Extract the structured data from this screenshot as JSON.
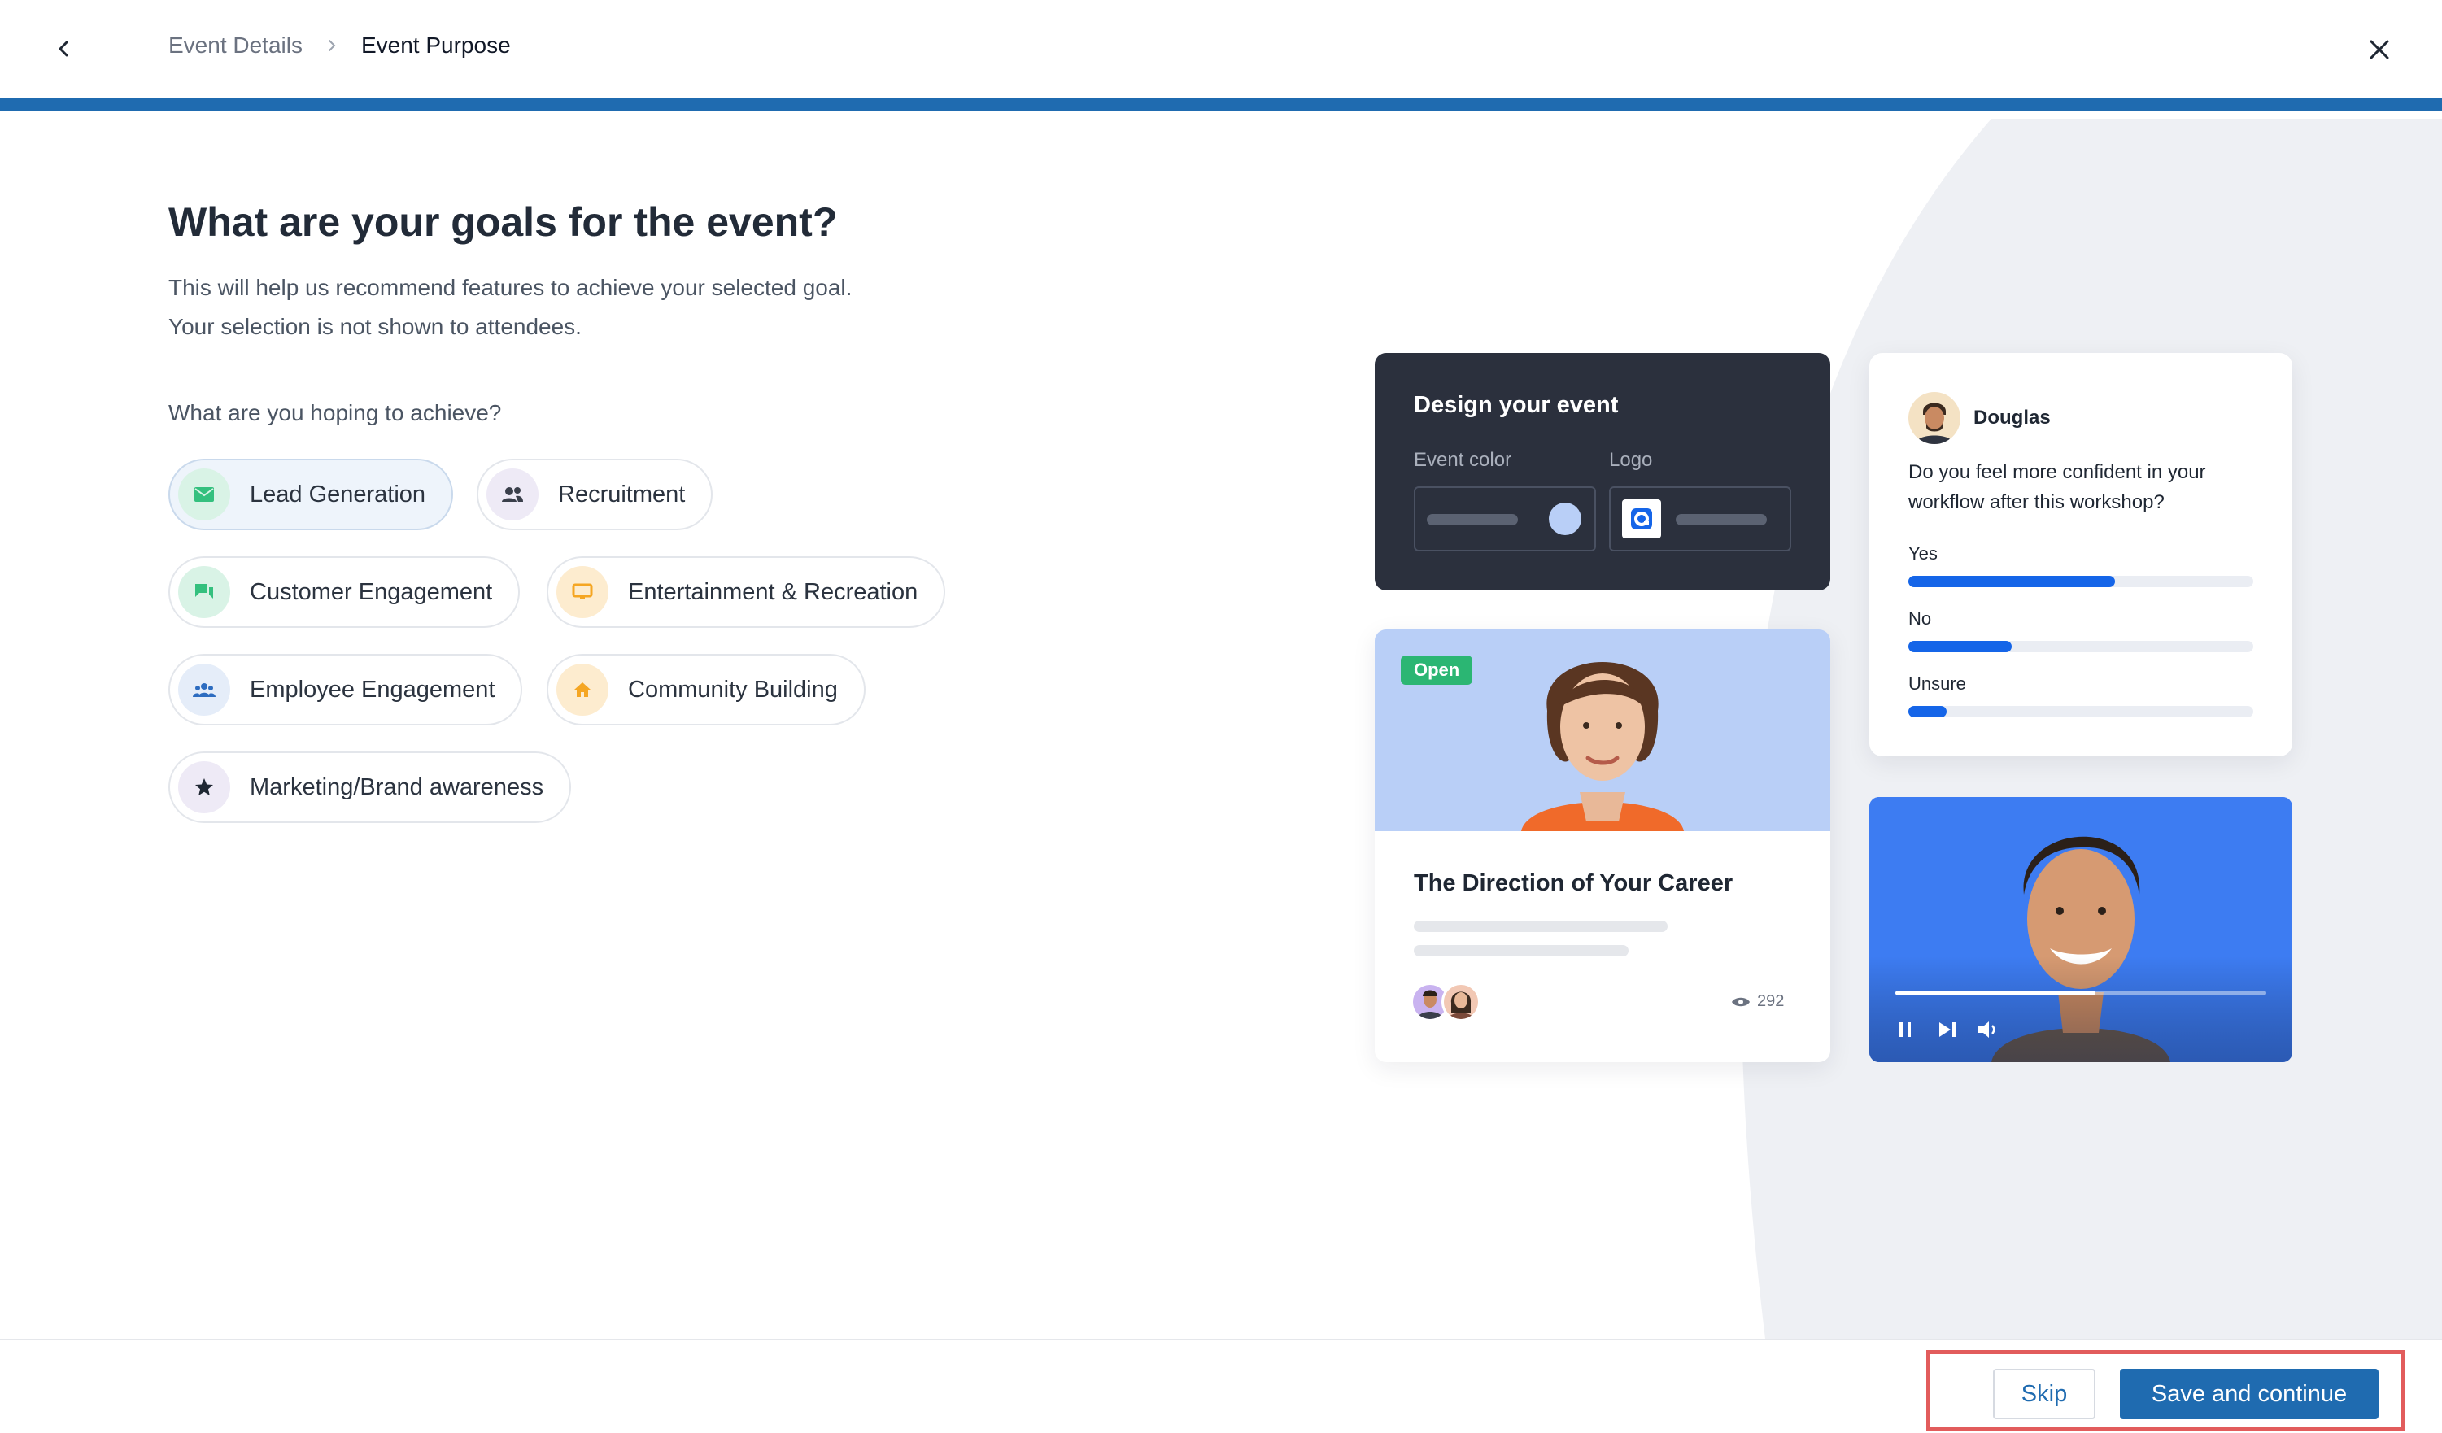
{
  "header": {
    "back_icon": "chevron-left-icon",
    "breadcrumb": {
      "previous": "Event Details",
      "separator_icon": "chevron-right-icon",
      "current": "Event Purpose"
    },
    "close_icon": "close-icon",
    "progress_fraction": 1.0
  },
  "main": {
    "title": "What are your goals for the event?",
    "subtitle_line1": "This will help us recommend features to achieve your selected goal.",
    "subtitle_line2": "Your selection is not shown to attendees.",
    "question": "What are you hoping to achieve?",
    "goals": [
      {
        "label": "Lead Generation",
        "icon": "mail-icon",
        "selected": true
      },
      {
        "label": "Recruitment",
        "icon": "people-icon",
        "selected": false
      },
      {
        "label": "Customer Engagement",
        "icon": "chat-icon",
        "selected": false
      },
      {
        "label": "Entertainment & Recreation",
        "icon": "monitor-icon",
        "selected": false
      },
      {
        "label": "Employee Engagement",
        "icon": "team-icon",
        "selected": false
      },
      {
        "label": "Community Building",
        "icon": "home-icon",
        "selected": false
      },
      {
        "label": "Marketing/Brand awareness",
        "icon": "star-icon",
        "selected": false
      }
    ]
  },
  "preview": {
    "design_card": {
      "title": "Design your event",
      "event_color_label": "Event color",
      "logo_label": "Logo"
    },
    "poll_card": {
      "user_name": "Douglas",
      "question": "Do you feel more confident in your workflow after this workshop?",
      "options": [
        {
          "label": "Yes",
          "fraction": 0.6
        },
        {
          "label": "No",
          "fraction": 0.3
        },
        {
          "label": "Unsure",
          "fraction": 0.11
        }
      ]
    },
    "session_card": {
      "badge": "Open",
      "title": "The Direction of Your Career",
      "views": "292"
    },
    "video_card": {
      "progress_fraction": 0.54
    }
  },
  "footer": {
    "skip_label": "Skip",
    "save_label": "Save and continue"
  },
  "colors": {
    "brand": "#1f6bb0",
    "selected_chip_bg": "#eef4fb",
    "poll_bar": "#1565e8",
    "open_badge": "#2bb673",
    "highlight_frame": "#e25c5c"
  }
}
